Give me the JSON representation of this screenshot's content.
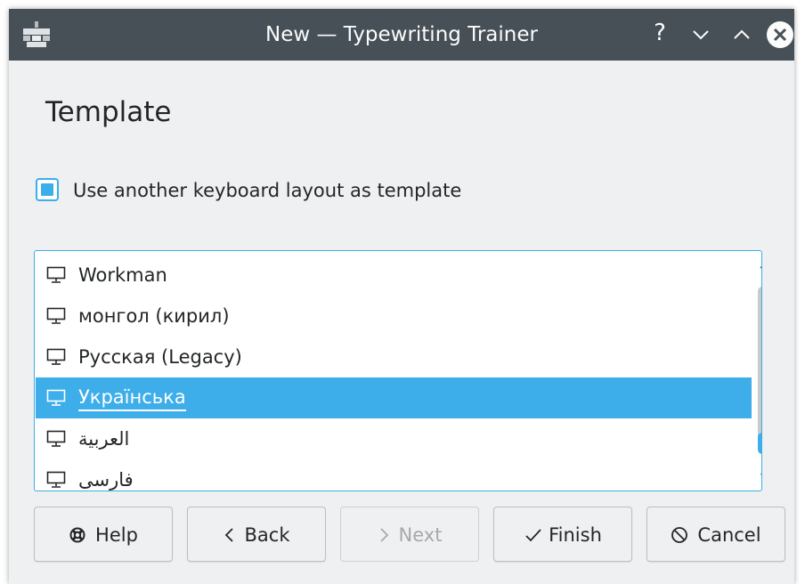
{
  "window": {
    "title": "New — Typewriting Trainer",
    "titlebar_color": "#475057",
    "accent_color": "#3daee9",
    "controls": {
      "help": "?"
    }
  },
  "page": {
    "heading": "Template",
    "checkbox": {
      "label": "Use another keyboard layout as template",
      "checked": true
    }
  },
  "layout_list": {
    "items": [
      {
        "label": "Workman",
        "icon": "monitor-icon"
      },
      {
        "label": "монгол (кирил)",
        "icon": "monitor-icon"
      },
      {
        "label": "Русская (Legacy)",
        "icon": "monitor-icon"
      },
      {
        "label": "Українська",
        "icon": "monitor-icon",
        "selected": true
      },
      {
        "label": "العربية",
        "icon": "monitor-icon"
      },
      {
        "label": "فارسی",
        "icon": "monitor-icon"
      }
    ]
  },
  "buttons": {
    "help": "Help",
    "back": "Back",
    "next": "Next",
    "finish": "Finish",
    "cancel": "Cancel"
  }
}
